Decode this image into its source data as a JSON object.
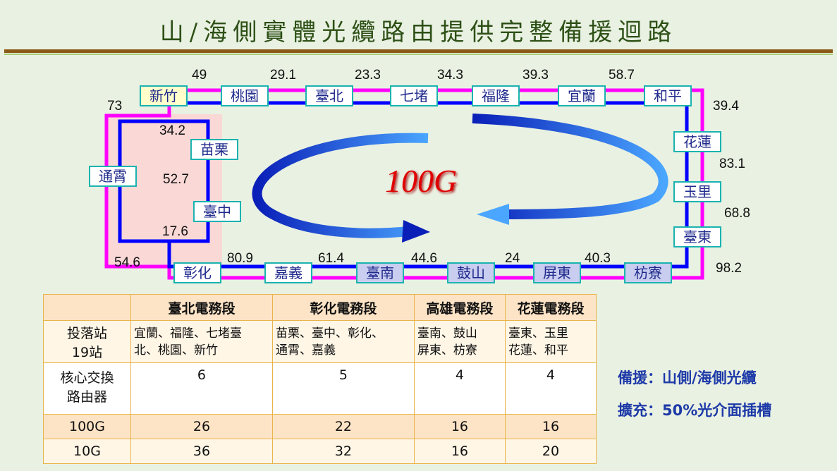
{
  "title": "山/海側實體光纜路由提供完整備援迴路",
  "speed_label": "100G",
  "stations": {
    "xinzhu": "新竹",
    "taoyuan": "桃園",
    "taibei": "臺北",
    "qidu": "七堵",
    "fulong": "福隆",
    "yilan": "宜蘭",
    "heping": "和平",
    "hualian": "花蓮",
    "yuli": "玉里",
    "taidong": "臺東",
    "fangliao": "枋寮",
    "pingdong": "屏東",
    "gushan": "鼓山",
    "tainan": "臺南",
    "jiayi": "嘉義",
    "zhanghua": "彰化",
    "taizhong": "臺中",
    "miaoli": "苗栗",
    "tongxiao": "通霄"
  },
  "distances": {
    "d1": "49",
    "d2": "29.1",
    "d3": "23.3",
    "d4": "34.3",
    "d5": "39.3",
    "d6": "58.7",
    "d7": "39.4",
    "d8": "83.1",
    "d9": "68.8",
    "d10": "98.2",
    "d11": "40.3",
    "d12": "24",
    "d13": "44.6",
    "d14": "61.4",
    "d15": "80.9",
    "d16": "54.6",
    "d17": "73",
    "d18": "34.2",
    "d19": "52.7",
    "d20": "17.6"
  },
  "table": {
    "headers": [
      "臺北電務段",
      "彰化電務段",
      "高雄電務段",
      "花蓮電務段"
    ],
    "row_stations": {
      "label1": "投落站",
      "label2": "19站",
      "cells": [
        [
          "宜蘭、福隆、七堵臺",
          "北、桃園、新竹"
        ],
        [
          "苗栗、臺中、彰化、",
          "通霄、嘉義"
        ],
        [
          "臺南、鼓山",
          "屏東、枋寮"
        ],
        [
          "臺東、玉里",
          "花蓮、和平"
        ]
      ]
    },
    "row_routers": {
      "label1": "核心交換",
      "label2": "路由器",
      "values": [
        "6",
        "5",
        "4",
        "4"
      ]
    },
    "row_100g": {
      "label": "100G",
      "values": [
        "26",
        "22",
        "16",
        "16"
      ]
    },
    "row_10g": {
      "label": "10G",
      "values": [
        "36",
        "32",
        "16",
        "20"
      ]
    }
  },
  "notes": {
    "backup": "備援：山側/海側光纜",
    "expand": "擴充：50%光介面插槽"
  },
  "colors": {
    "mountain_line": "#ff00ff",
    "sea_line": "#0000ff",
    "title": "#2d5016",
    "arrow": "#1e5fd6",
    "speed": "#e00000"
  }
}
